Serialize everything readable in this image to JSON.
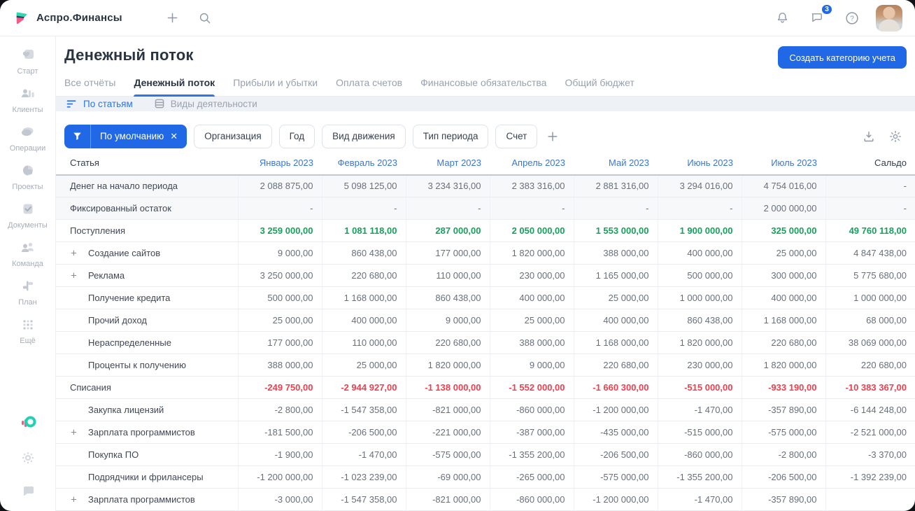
{
  "colors": {
    "accent_blue": "#2068e6",
    "income_green": "#17a05c",
    "expense_red": "#ee3f4f",
    "link_blue": "#3a76d8"
  },
  "topbar": {
    "brand": "Аспро.Финансы",
    "chat_badge": "3"
  },
  "sidebar": {
    "items": [
      {
        "label": "Старт",
        "icon": "start-icon"
      },
      {
        "label": "Клиенты",
        "icon": "clients-icon"
      },
      {
        "label": "Операции",
        "icon": "operations-icon"
      },
      {
        "label": "Проекты",
        "icon": "projects-icon"
      },
      {
        "label": "Документы",
        "icon": "documents-icon"
      },
      {
        "label": "Команда",
        "icon": "team-icon"
      },
      {
        "label": "План",
        "icon": "plan-icon"
      },
      {
        "label": "Ещё",
        "icon": "more-dots-icon"
      }
    ],
    "footer_icons": [
      "app-logo-icon",
      "gear-icon",
      "chat-bubble-icon"
    ]
  },
  "page": {
    "title": "Денежный поток",
    "create_button": "Создать категорию учета"
  },
  "tabs": [
    {
      "label": "Все отчёты",
      "active": false
    },
    {
      "label": "Денежный поток",
      "active": true
    },
    {
      "label": "Прибыли и убытки",
      "active": false
    },
    {
      "label": "Оплата счетов",
      "active": false
    },
    {
      "label": "Финансовые обязательства",
      "active": false
    },
    {
      "label": "Общий бюджет",
      "active": false
    }
  ],
  "view_switch": [
    {
      "label": "По статьям",
      "icon": "sort-lines-icon",
      "active": true
    },
    {
      "label": "Виды деятельности",
      "icon": "stack-icon",
      "active": false
    }
  ],
  "filters": {
    "primary_label": "По умолчанию",
    "chips": [
      "Организация",
      "Год",
      "Вид движения",
      "Тип периода",
      "Счет"
    ]
  },
  "table": {
    "columns": [
      "Статья",
      "Январь 2023",
      "Февраль 2023",
      "Март 2023",
      "Апрель 2023",
      "Май 2023",
      "Июнь 2023",
      "Июль 2023",
      "Сальдо"
    ],
    "rows": [
      {
        "label": "Денег на начало периода",
        "type": "opening",
        "expandable": false,
        "values": [
          "2 088 875,00",
          "5 098 125,00",
          "3 234 316,00",
          "2 383 316,00",
          "2 881 316,00",
          "3 294 016,00",
          "4 754 016,00",
          "-"
        ]
      },
      {
        "label": "Фиксированный остаток",
        "type": "opening",
        "expandable": false,
        "values": [
          "-",
          "-",
          "-",
          "-",
          "-",
          "-",
          "2 000 000,00",
          "-"
        ]
      },
      {
        "label": "Поступления",
        "type": "income",
        "expandable": false,
        "values": [
          "3 259 000,00",
          "1 081 118,00",
          "287 000,00",
          "2 050 000,00",
          "1 553 000,00",
          "1 900 000,00",
          "325 000,00",
          "49 760 118,00"
        ]
      },
      {
        "label": "Создание сайтов",
        "type": "child",
        "expandable": true,
        "values": [
          "9 000,00",
          "860 438,00",
          "177 000,00",
          "1 820 000,00",
          "388 000,00",
          "400 000,00",
          "25 000,00",
          "4 847 438,00"
        ]
      },
      {
        "label": "Реклама",
        "type": "child",
        "expandable": true,
        "values": [
          "3 250 000,00",
          "220 680,00",
          "110 000,00",
          "230 000,00",
          "1 165 000,00",
          "500 000,00",
          "300 000,00",
          "5 775 680,00"
        ]
      },
      {
        "label": "Получение кредита",
        "type": "child",
        "expandable": false,
        "values": [
          "500 000,00",
          "1 168 000,00",
          "860 438,00",
          "400 000,00",
          "25 000,00",
          "1 000 000,00",
          "400 000,00",
          "1 000 000,00"
        ]
      },
      {
        "label": "Прочий доход",
        "type": "child",
        "expandable": false,
        "values": [
          "25 000,00",
          "400 000,00",
          "9 000,00",
          "25 000,00",
          "400 000,00",
          "860 438,00",
          "1 168 000,00",
          "68 000,00"
        ]
      },
      {
        "label": "Нераспределенные",
        "type": "child",
        "expandable": false,
        "values": [
          "177 000,00",
          "110 000,00",
          "220 680,00",
          "388 000,00",
          "1 168 000,00",
          "1 820 000,00",
          "220 680,00",
          "38 069 000,00"
        ]
      },
      {
        "label": "Проценты к получению",
        "type": "child",
        "expandable": false,
        "values": [
          "388 000,00",
          "25 000,00",
          "1 820 000,00",
          "9 000,00",
          "220 680,00",
          "230 000,00",
          "1 820 000,00",
          "220 680,00"
        ]
      },
      {
        "label": "Списания",
        "type": "expense",
        "expandable": false,
        "values": [
          "-249 750,00",
          "-2 944 927,00",
          "-1 138 000,00",
          "-1 552 000,00",
          "-1 660 300,00",
          "-515 000,00",
          "-933 190,00",
          "-10 383 367,00"
        ]
      },
      {
        "label": "Закупка лицензий",
        "type": "child",
        "expandable": false,
        "values": [
          "-2 800,00",
          "-1 547 358,00",
          "-821 000,00",
          "-860 000,00",
          "-1 200 000,00",
          "-1 470,00",
          "-357 890,00",
          "-6 144 248,00"
        ]
      },
      {
        "label": "Зарплата программистов",
        "type": "child",
        "expandable": true,
        "values": [
          "-181 500,00",
          "-206 500,00",
          "-221 000,00",
          "-387 000,00",
          "-435 000,00",
          "-515 000,00",
          "-575 000,00",
          "-2 521 000,00"
        ]
      },
      {
        "label": "Покупка ПО",
        "type": "child",
        "expandable": false,
        "values": [
          "-1 900,00",
          "-1 470,00",
          "-575 000,00",
          "-1 355 200,00",
          "-206 500,00",
          "-860 000,00",
          "-2 800,00",
          "-3 370,00"
        ]
      },
      {
        "label": "Подрядчики и фрилансеры",
        "type": "child",
        "expandable": false,
        "values": [
          "-1 200 000,00",
          "-1 023 239,00",
          "-69 000,00",
          "-265 000,00",
          "-575 000,00",
          "-1 355 200,00",
          "-206 500,00",
          "-1 392 239,00"
        ]
      },
      {
        "label": "Зарплата программистов",
        "type": "child",
        "expandable": true,
        "values": [
          "-3 000,00",
          "-1 547 358,00",
          "-821 000,00",
          "-860 000,00",
          "-1 200 000,00",
          "-1 470,00",
          "-357 890,00",
          ""
        ]
      }
    ]
  }
}
